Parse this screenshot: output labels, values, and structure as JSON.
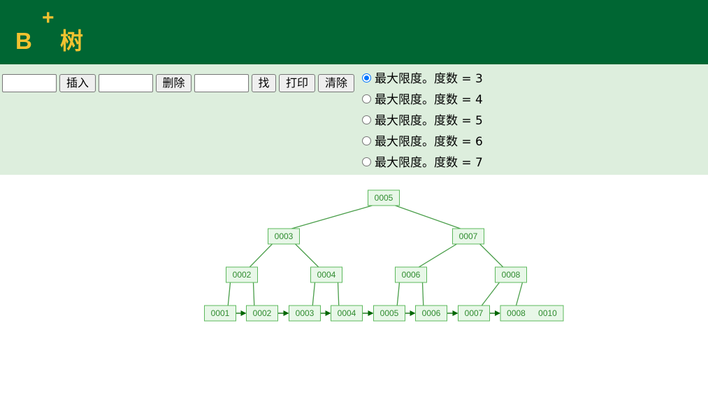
{
  "header": {
    "logo_letter": "B",
    "logo_plus": "+",
    "logo_word": "树"
  },
  "controls": {
    "insert_value": "",
    "insert_button": "插入",
    "delete_value": "",
    "delete_button": "删除",
    "find_value": "",
    "find_button": "找",
    "print_button": "打印",
    "clear_button": "清除"
  },
  "degree_options": [
    {
      "label": "最大限度。度数 = 3",
      "selected": true
    },
    {
      "label": "最大限度。度数 = 4",
      "selected": false
    },
    {
      "label": "最大限度。度数 = 5",
      "selected": false
    },
    {
      "label": "最大限度。度数 = 6",
      "selected": false
    },
    {
      "label": "最大限度。度数 = 7",
      "selected": false
    }
  ],
  "colors": {
    "header_bg": "#006633",
    "logo": "#f2c230",
    "panel_bg": "#ddeedd",
    "node_fill": "#e8f7e8",
    "node_stroke": "#5cb85c",
    "node_text": "#2e8b2e",
    "edge": "#4a9e4a",
    "leaf_link": "#006600",
    "radio_accent": "#0075ff"
  },
  "tree": {
    "root": [
      "0005"
    ],
    "level1": [
      [
        "0003"
      ],
      [
        "0007"
      ]
    ],
    "level2": [
      [
        "0002"
      ],
      [
        "0004"
      ],
      [
        "0006"
      ],
      [
        "0008"
      ]
    ],
    "leaves": [
      [
        "0001"
      ],
      [
        "0002"
      ],
      [
        "0003"
      ],
      [
        "0004"
      ],
      [
        "0005"
      ],
      [
        "0006"
      ],
      [
        "0007"
      ],
      [
        "0008",
        "0010"
      ]
    ]
  }
}
